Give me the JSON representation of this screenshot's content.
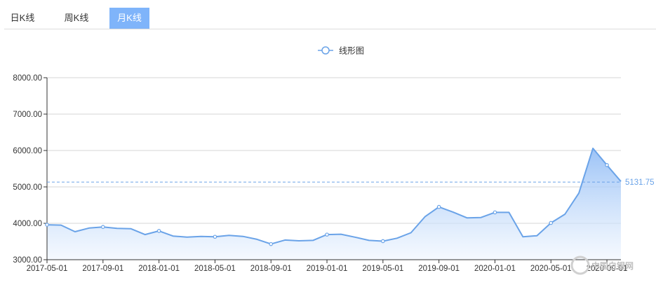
{
  "tabs": [
    {
      "label": "日K线",
      "active": false
    },
    {
      "label": "周K线",
      "active": false
    },
    {
      "label": "月K线",
      "active": true
    }
  ],
  "colors": {
    "accent": "#6aa3e8",
    "tab_active_bg": "#7fb4fa",
    "axis": "#333333",
    "grid": "#cccccc"
  },
  "watermark": "中国白银网",
  "chart_data": {
    "type": "area",
    "title": "",
    "xlabel": "",
    "ylabel": "",
    "ylim": [
      3000,
      8000
    ],
    "y_ticks": [
      3000,
      4000,
      5000,
      6000,
      7000,
      8000
    ],
    "y_tick_labels": [
      "3000.00",
      "4000.00",
      "5000.00",
      "6000.00",
      "7000.00",
      "8000.00"
    ],
    "x_tick_labels": [
      "2017-05-01",
      "2017-09-01",
      "2018-01-01",
      "2018-05-01",
      "2018-09-01",
      "2019-01-01",
      "2019-05-01",
      "2019-09-01",
      "2020-01-01",
      "2020-05-01",
      "2020-09-01"
    ],
    "grid": true,
    "legend": {
      "position": "top-center",
      "entries": [
        "线形图"
      ]
    },
    "markline": {
      "value": 5131.75,
      "label": "5131.75",
      "style": "dashed"
    },
    "series": [
      {
        "name": "线形图",
        "x": [
          "2017-05-01",
          "2017-06-01",
          "2017-07-01",
          "2017-08-01",
          "2017-09-01",
          "2017-10-01",
          "2017-11-01",
          "2017-12-01",
          "2018-01-01",
          "2018-02-01",
          "2018-03-01",
          "2018-04-01",
          "2018-05-01",
          "2018-06-01",
          "2018-07-01",
          "2018-08-01",
          "2018-09-01",
          "2018-10-01",
          "2018-11-01",
          "2018-12-01",
          "2019-01-01",
          "2019-02-01",
          "2019-03-01",
          "2019-04-01",
          "2019-05-01",
          "2019-06-01",
          "2019-07-01",
          "2019-08-01",
          "2019-09-01",
          "2019-10-01",
          "2019-11-01",
          "2019-12-01",
          "2020-01-01",
          "2020-02-01",
          "2020-03-01",
          "2020-04-01",
          "2020-05-01",
          "2020-06-01",
          "2020-07-01",
          "2020-08-01",
          "2020-09-01",
          "2020-10-01"
        ],
        "values": [
          3960,
          3950,
          3770,
          3870,
          3900,
          3860,
          3850,
          3690,
          3790,
          3650,
          3620,
          3640,
          3630,
          3670,
          3640,
          3560,
          3430,
          3540,
          3520,
          3530,
          3690,
          3700,
          3620,
          3530,
          3510,
          3590,
          3740,
          4180,
          4450,
          4310,
          4150,
          4160,
          4300,
          4300,
          3630,
          3660,
          4010,
          4250,
          4830,
          6060,
          5600,
          5150
        ]
      }
    ]
  }
}
